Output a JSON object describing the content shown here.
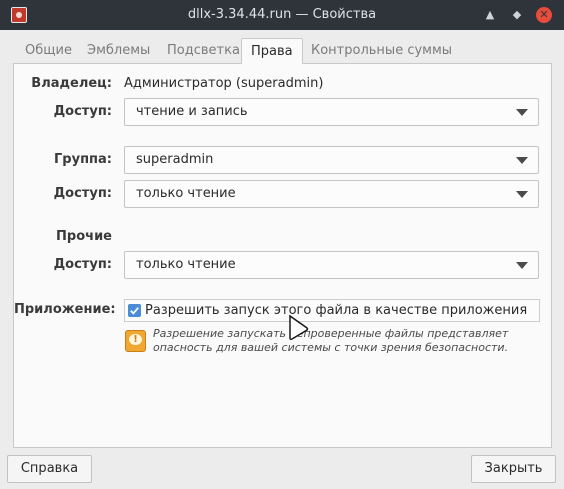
{
  "window": {
    "title": "dllx-3.34.44.run — Свойства",
    "app_icon": "app-icon",
    "controls": [
      "minimize-icon",
      "restore-icon",
      "close-icon"
    ]
  },
  "tabs": [
    {
      "label": "Общие",
      "active": false
    },
    {
      "label": "Эмблемы",
      "active": false
    },
    {
      "label": "Подсветка",
      "active": false
    },
    {
      "label": "Права",
      "active": true
    },
    {
      "label": "Контрольные суммы",
      "active": false
    }
  ],
  "permissions": {
    "owner_label": "Владелец:",
    "owner_value": "Администратор (superadmin)",
    "owner_access_label": "Доступ:",
    "owner_access_value": "чтение и запись",
    "group_label": "Группа:",
    "group_value": "superadmin",
    "group_access_label": "Доступ:",
    "group_access_value": "только чтение",
    "others_label": "Прочие",
    "others_access_label": "Доступ:",
    "others_access_value": "только чтение",
    "program_label": "Приложение:",
    "program_checkbox_label": "Разрешить запуск этого файла в качестве приложения",
    "program_checked": true,
    "warning_text": "Разрешение запускать непроверенные файлы представляет опасность для вашей системы с точки зрения безопасности."
  },
  "footer": {
    "help_label": "Справка",
    "close_label": "Закрыть"
  },
  "colors": {
    "titlebar": "#2f343a",
    "accent": "#4a8cd6",
    "close_button": "#e74c3c",
    "warning": "#f0a830"
  }
}
